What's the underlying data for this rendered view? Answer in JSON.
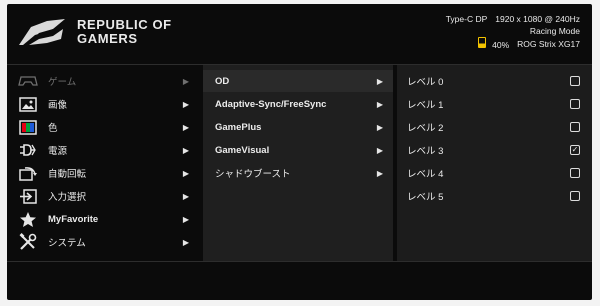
{
  "header": {
    "brand_line1": "REPUBLIC OF",
    "brand_line2": "GAMERS",
    "input": "Type-C DP",
    "resolution": "1920 x 1080 @  240Hz",
    "mode": "Racing Mode",
    "battery": "40%",
    "model": "ROG Strix XG17"
  },
  "left_menu": [
    {
      "label": "ゲーム",
      "icon": "gamepad-icon"
    },
    {
      "label": "画像",
      "icon": "image-icon"
    },
    {
      "label": "色",
      "icon": "color-icon"
    },
    {
      "label": "電源",
      "icon": "power-icon"
    },
    {
      "label": "自動回転",
      "icon": "auto-rotate-icon"
    },
    {
      "label": "入力選択",
      "icon": "input-select-icon"
    },
    {
      "label": "MyFavorite",
      "icon": "star-icon"
    },
    {
      "label": "システム",
      "icon": "tools-icon"
    }
  ],
  "mid_menu": [
    {
      "label": "OD"
    },
    {
      "label": "Adaptive-Sync/FreeSync"
    },
    {
      "label": "GamePlus"
    },
    {
      "label": "GameVisual"
    },
    {
      "label": "シャドウブースト"
    }
  ],
  "right_menu": [
    {
      "label": "レベル 0",
      "checked": false
    },
    {
      "label": "レベル 1",
      "checked": false
    },
    {
      "label": "レベル 2",
      "checked": false
    },
    {
      "label": "レベル 3",
      "checked": true
    },
    {
      "label": "レベル 4",
      "checked": false
    },
    {
      "label": "レベル 5",
      "checked": false
    }
  ],
  "glyphs": {
    "arrow": "▶",
    "check": "✓"
  },
  "colors": {
    "background": "#0b0b0b",
    "accent": "#e60012",
    "battery": "#f3c300"
  }
}
